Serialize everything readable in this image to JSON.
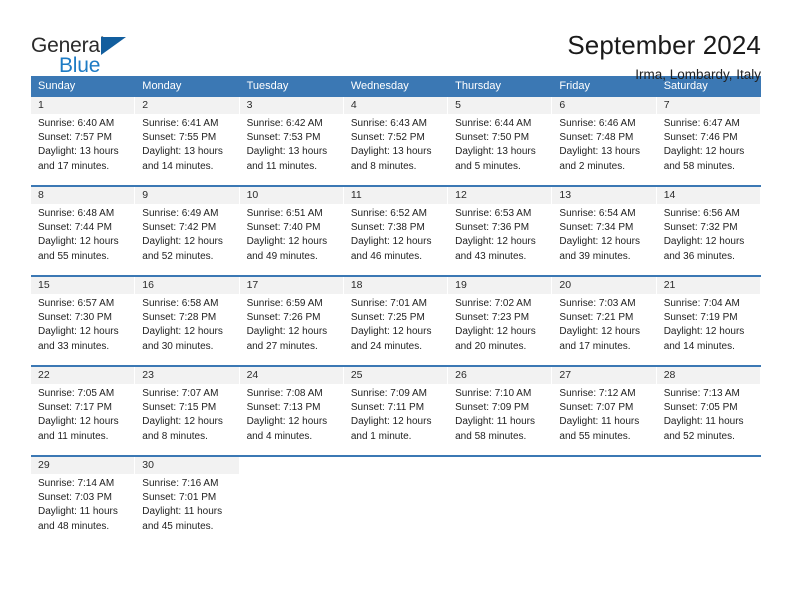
{
  "brand": {
    "name_top": "General",
    "name_bottom": "Blue",
    "triangle_color": "#125e9e",
    "blue": "#1e7bc4"
  },
  "header": {
    "title": "September 2024",
    "subtitle": "Irma, Lombardy, Italy"
  },
  "theme": {
    "header_bg": "#3b78b4",
    "header_text": "#ffffff",
    "daynum_bg": "#f2f2f2",
    "cell_bg": "#ffffff",
    "text": "#1f1f1f"
  },
  "weekday_headers": [
    "Sunday",
    "Monday",
    "Tuesday",
    "Wednesday",
    "Thursday",
    "Friday",
    "Saturday"
  ],
  "labels": {
    "sunrise_prefix": "Sunrise:",
    "sunset_prefix": "Sunset:",
    "daylight_prefix": "Daylight:"
  },
  "weeks": [
    [
      {
        "day": "1",
        "sunrise": "Sunrise: 6:40 AM",
        "sunset": "Sunset: 7:57 PM",
        "daylight_line1": "Daylight: 13 hours",
        "daylight_line2": "and 17 minutes."
      },
      {
        "day": "2",
        "sunrise": "Sunrise: 6:41 AM",
        "sunset": "Sunset: 7:55 PM",
        "daylight_line1": "Daylight: 13 hours",
        "daylight_line2": "and 14 minutes."
      },
      {
        "day": "3",
        "sunrise": "Sunrise: 6:42 AM",
        "sunset": "Sunset: 7:53 PM",
        "daylight_line1": "Daylight: 13 hours",
        "daylight_line2": "and 11 minutes."
      },
      {
        "day": "4",
        "sunrise": "Sunrise: 6:43 AM",
        "sunset": "Sunset: 7:52 PM",
        "daylight_line1": "Daylight: 13 hours",
        "daylight_line2": "and 8 minutes."
      },
      {
        "day": "5",
        "sunrise": "Sunrise: 6:44 AM",
        "sunset": "Sunset: 7:50 PM",
        "daylight_line1": "Daylight: 13 hours",
        "daylight_line2": "and 5 minutes."
      },
      {
        "day": "6",
        "sunrise": "Sunrise: 6:46 AM",
        "sunset": "Sunset: 7:48 PM",
        "daylight_line1": "Daylight: 13 hours",
        "daylight_line2": "and 2 minutes."
      },
      {
        "day": "7",
        "sunrise": "Sunrise: 6:47 AM",
        "sunset": "Sunset: 7:46 PM",
        "daylight_line1": "Daylight: 12 hours",
        "daylight_line2": "and 58 minutes."
      }
    ],
    [
      {
        "day": "8",
        "sunrise": "Sunrise: 6:48 AM",
        "sunset": "Sunset: 7:44 PM",
        "daylight_line1": "Daylight: 12 hours",
        "daylight_line2": "and 55 minutes."
      },
      {
        "day": "9",
        "sunrise": "Sunrise: 6:49 AM",
        "sunset": "Sunset: 7:42 PM",
        "daylight_line1": "Daylight: 12 hours",
        "daylight_line2": "and 52 minutes."
      },
      {
        "day": "10",
        "sunrise": "Sunrise: 6:51 AM",
        "sunset": "Sunset: 7:40 PM",
        "daylight_line1": "Daylight: 12 hours",
        "daylight_line2": "and 49 minutes."
      },
      {
        "day": "11",
        "sunrise": "Sunrise: 6:52 AM",
        "sunset": "Sunset: 7:38 PM",
        "daylight_line1": "Daylight: 12 hours",
        "daylight_line2": "and 46 minutes."
      },
      {
        "day": "12",
        "sunrise": "Sunrise: 6:53 AM",
        "sunset": "Sunset: 7:36 PM",
        "daylight_line1": "Daylight: 12 hours",
        "daylight_line2": "and 43 minutes."
      },
      {
        "day": "13",
        "sunrise": "Sunrise: 6:54 AM",
        "sunset": "Sunset: 7:34 PM",
        "daylight_line1": "Daylight: 12 hours",
        "daylight_line2": "and 39 minutes."
      },
      {
        "day": "14",
        "sunrise": "Sunrise: 6:56 AM",
        "sunset": "Sunset: 7:32 PM",
        "daylight_line1": "Daylight: 12 hours",
        "daylight_line2": "and 36 minutes."
      }
    ],
    [
      {
        "day": "15",
        "sunrise": "Sunrise: 6:57 AM",
        "sunset": "Sunset: 7:30 PM",
        "daylight_line1": "Daylight: 12 hours",
        "daylight_line2": "and 33 minutes."
      },
      {
        "day": "16",
        "sunrise": "Sunrise: 6:58 AM",
        "sunset": "Sunset: 7:28 PM",
        "daylight_line1": "Daylight: 12 hours",
        "daylight_line2": "and 30 minutes."
      },
      {
        "day": "17",
        "sunrise": "Sunrise: 6:59 AM",
        "sunset": "Sunset: 7:26 PM",
        "daylight_line1": "Daylight: 12 hours",
        "daylight_line2": "and 27 minutes."
      },
      {
        "day": "18",
        "sunrise": "Sunrise: 7:01 AM",
        "sunset": "Sunset: 7:25 PM",
        "daylight_line1": "Daylight: 12 hours",
        "daylight_line2": "and 24 minutes."
      },
      {
        "day": "19",
        "sunrise": "Sunrise: 7:02 AM",
        "sunset": "Sunset: 7:23 PM",
        "daylight_line1": "Daylight: 12 hours",
        "daylight_line2": "and 20 minutes."
      },
      {
        "day": "20",
        "sunrise": "Sunrise: 7:03 AM",
        "sunset": "Sunset: 7:21 PM",
        "daylight_line1": "Daylight: 12 hours",
        "daylight_line2": "and 17 minutes."
      },
      {
        "day": "21",
        "sunrise": "Sunrise: 7:04 AM",
        "sunset": "Sunset: 7:19 PM",
        "daylight_line1": "Daylight: 12 hours",
        "daylight_line2": "and 14 minutes."
      }
    ],
    [
      {
        "day": "22",
        "sunrise": "Sunrise: 7:05 AM",
        "sunset": "Sunset: 7:17 PM",
        "daylight_line1": "Daylight: 12 hours",
        "daylight_line2": "and 11 minutes."
      },
      {
        "day": "23",
        "sunrise": "Sunrise: 7:07 AM",
        "sunset": "Sunset: 7:15 PM",
        "daylight_line1": "Daylight: 12 hours",
        "daylight_line2": "and 8 minutes."
      },
      {
        "day": "24",
        "sunrise": "Sunrise: 7:08 AM",
        "sunset": "Sunset: 7:13 PM",
        "daylight_line1": "Daylight: 12 hours",
        "daylight_line2": "and 4 minutes."
      },
      {
        "day": "25",
        "sunrise": "Sunrise: 7:09 AM",
        "sunset": "Sunset: 7:11 PM",
        "daylight_line1": "Daylight: 12 hours",
        "daylight_line2": "and 1 minute."
      },
      {
        "day": "26",
        "sunrise": "Sunrise: 7:10 AM",
        "sunset": "Sunset: 7:09 PM",
        "daylight_line1": "Daylight: 11 hours",
        "daylight_line2": "and 58 minutes."
      },
      {
        "day": "27",
        "sunrise": "Sunrise: 7:12 AM",
        "sunset": "Sunset: 7:07 PM",
        "daylight_line1": "Daylight: 11 hours",
        "daylight_line2": "and 55 minutes."
      },
      {
        "day": "28",
        "sunrise": "Sunrise: 7:13 AM",
        "sunset": "Sunset: 7:05 PM",
        "daylight_line1": "Daylight: 11 hours",
        "daylight_line2": "and 52 minutes."
      }
    ],
    [
      {
        "day": "29",
        "sunrise": "Sunrise: 7:14 AM",
        "sunset": "Sunset: 7:03 PM",
        "daylight_line1": "Daylight: 11 hours",
        "daylight_line2": "and 48 minutes."
      },
      {
        "day": "30",
        "sunrise": "Sunrise: 7:16 AM",
        "sunset": "Sunset: 7:01 PM",
        "daylight_line1": "Daylight: 11 hours",
        "daylight_line2": "and 45 minutes."
      },
      {
        "day": "",
        "sunrise": "",
        "sunset": "",
        "daylight_line1": "",
        "daylight_line2": ""
      },
      {
        "day": "",
        "sunrise": "",
        "sunset": "",
        "daylight_line1": "",
        "daylight_line2": ""
      },
      {
        "day": "",
        "sunrise": "",
        "sunset": "",
        "daylight_line1": "",
        "daylight_line2": ""
      },
      {
        "day": "",
        "sunrise": "",
        "sunset": "",
        "daylight_line1": "",
        "daylight_line2": ""
      },
      {
        "day": "",
        "sunrise": "",
        "sunset": "",
        "daylight_line1": "",
        "daylight_line2": ""
      }
    ]
  ]
}
